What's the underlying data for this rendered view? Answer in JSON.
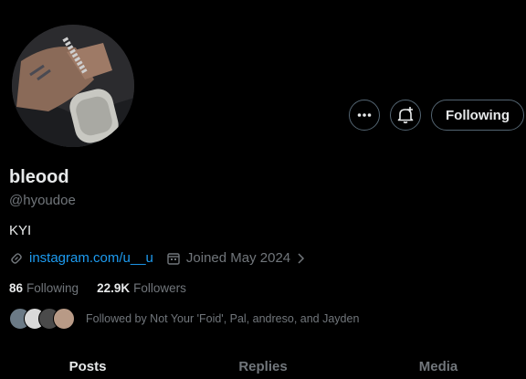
{
  "profile": {
    "display_name": "bleood",
    "handle": "@hyoudoe",
    "bio": "KYI",
    "link": "instagram.com/u__u",
    "joined": "Joined May 2024",
    "following_count": "86",
    "following_label": "Following",
    "followers_count": "22.9K",
    "followers_label": "Followers",
    "followed_by": "Followed by Not Your 'Foid', Pal, andreso, and Jayden"
  },
  "actions": {
    "more_icon": "more-horizontal-icon",
    "notify_icon": "bell-plus-icon",
    "follow_label": "Following"
  },
  "tabs": [
    {
      "label": "Posts",
      "active": true
    },
    {
      "label": "Replies",
      "active": false
    },
    {
      "label": "Media",
      "active": false
    }
  ],
  "colors": {
    "background": "#000000",
    "text": "#e7e9ea",
    "muted": "#71767b",
    "link": "#1d9bf0"
  }
}
